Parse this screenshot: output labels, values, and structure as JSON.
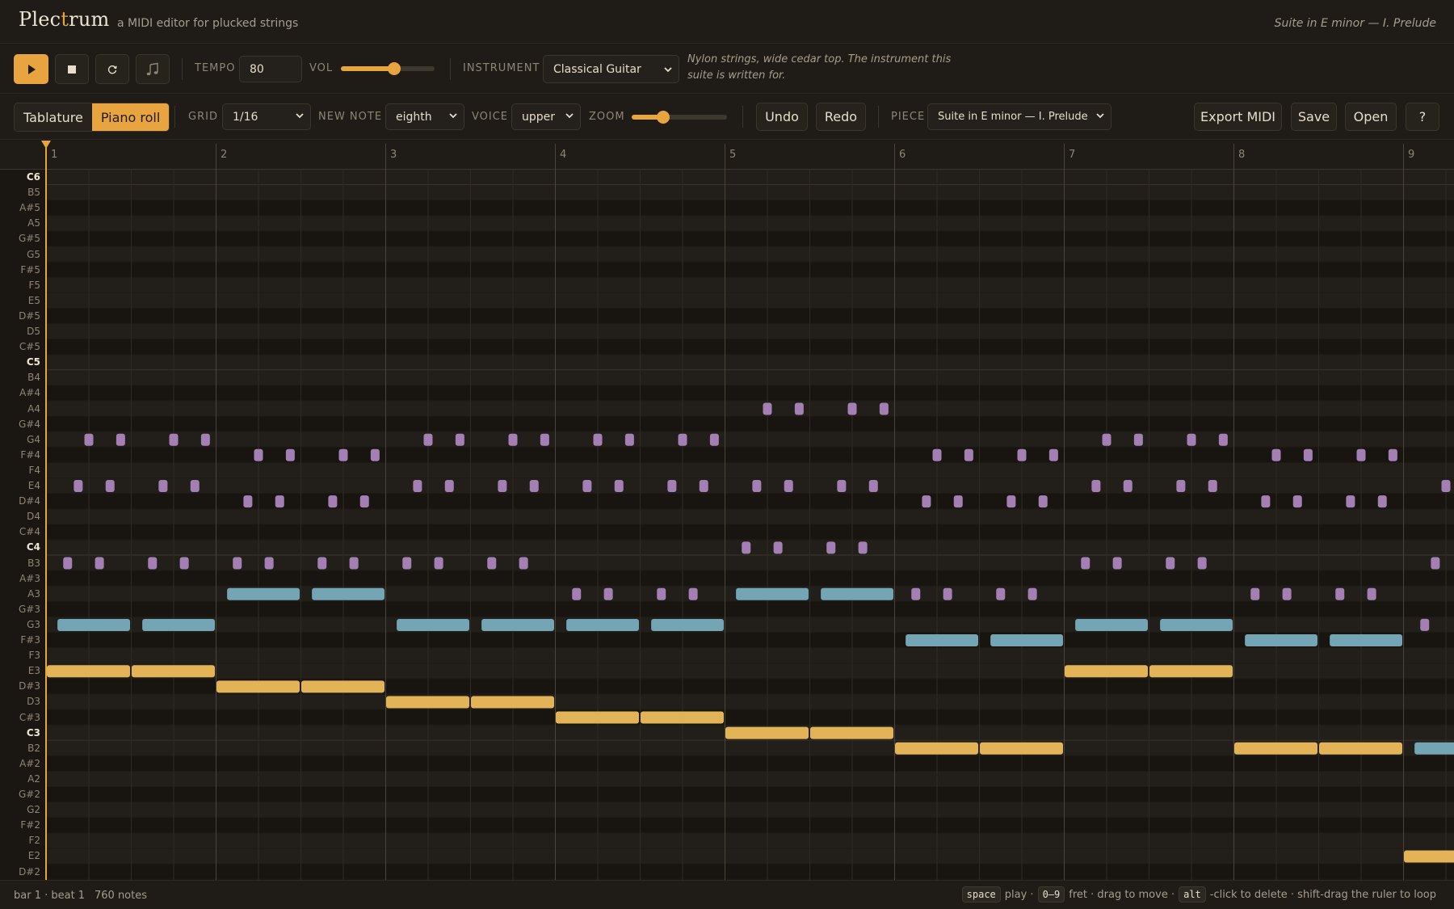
{
  "app": {
    "name": "Plectrum",
    "tagline": "a MIDI editor for plucked strings",
    "current_piece": "Suite in E minor — I. Prelude"
  },
  "transport": {
    "tempo_label": "TEMPO",
    "tempo": "80",
    "vol_label": "VOL",
    "volume": 0.58,
    "instrument_label": "INSTRUMENT",
    "instrument": "Classical Guitar",
    "instrument_description": "Nylon strings, wide cedar top. The instrument this suite is written for."
  },
  "editbar": {
    "views": [
      "Tablature",
      "Piano roll"
    ],
    "active_view": "Piano roll",
    "grid_label": "GRID",
    "grid": "1/16",
    "new_note_label": "NEW NOTE",
    "new_note": "eighth",
    "voice_label": "VOICE",
    "voice": "upper",
    "zoom_label": "ZOOM",
    "zoom": 0.3,
    "undo": "Undo",
    "redo": "Redo",
    "piece_label": "PIECE",
    "piece": "Suite in E minor — I. Prelude",
    "export": "Export MIDI",
    "save": "Save",
    "open": "Open",
    "help": "?"
  },
  "roll": {
    "bar_numbers": [
      "1",
      "2",
      "3",
      "4",
      "5",
      "6",
      "7",
      "8",
      "9"
    ],
    "pitches": [
      "C6",
      "B5",
      "A#5",
      "A5",
      "G#5",
      "G5",
      "F#5",
      "F5",
      "E5",
      "D#5",
      "D5",
      "C#5",
      "C5",
      "B4",
      "A#4",
      "A4",
      "G#4",
      "G4",
      "F#4",
      "F4",
      "E4",
      "D#4",
      "D4",
      "C#4",
      "C4",
      "B3",
      "A#3",
      "A3",
      "G#3",
      "G3",
      "F#3",
      "F3",
      "E3",
      "D#3",
      "D3",
      "C#3",
      "C3",
      "B2",
      "A#2",
      "A2",
      "G#2",
      "G2",
      "F#2",
      "F2",
      "E2",
      "D#2"
    ],
    "colors": {
      "bass": "#e2b457",
      "middle": "#74a5b5",
      "upper": "#a47fb4",
      "playhead": "#e8a43e"
    },
    "bass": [
      [
        "E3",
        1,
        0.5
      ],
      [
        "E3",
        1.5,
        0.5
      ],
      [
        "D#3",
        2,
        0.5
      ],
      [
        "D#3",
        2.5,
        0.5
      ],
      [
        "D3",
        3,
        0.5
      ],
      [
        "D3",
        3.5,
        0.5
      ],
      [
        "C#3",
        4,
        0.5
      ],
      [
        "C#3",
        4.5,
        0.5
      ],
      [
        "C3",
        5,
        0.5
      ],
      [
        "C3",
        5.5,
        0.5
      ],
      [
        "B2",
        6,
        0.5
      ],
      [
        "B2",
        6.5,
        0.5
      ],
      [
        "E3",
        7,
        0.5
      ],
      [
        "E3",
        7.5,
        0.5
      ],
      [
        "B2",
        8,
        0.5
      ],
      [
        "B2",
        8.5,
        0.5
      ],
      [
        "E2",
        9,
        0.5
      ]
    ],
    "middle": [
      [
        "G3",
        1.0625,
        0.4375
      ],
      [
        "G3",
        1.5625,
        0.4375
      ],
      [
        "A3",
        2.0625,
        0.4375
      ],
      [
        "A3",
        2.5625,
        0.4375
      ],
      [
        "G3",
        3.0625,
        0.4375
      ],
      [
        "G3",
        3.5625,
        0.4375
      ],
      [
        "G3",
        4.0625,
        0.4375
      ],
      [
        "G3",
        4.5625,
        0.4375
      ],
      [
        "A3",
        5.0625,
        0.4375
      ],
      [
        "A3",
        5.5625,
        0.4375
      ],
      [
        "F#3",
        6.0625,
        0.4375
      ],
      [
        "F#3",
        6.5625,
        0.4375
      ],
      [
        "G3",
        7.0625,
        0.4375
      ],
      [
        "G3",
        7.5625,
        0.4375
      ],
      [
        "F#3",
        8.0625,
        0.4375
      ],
      [
        "F#3",
        8.5625,
        0.4375
      ],
      [
        "B2",
        9.0625,
        0.4375
      ]
    ],
    "upper": [
      [
        "B3",
        1.125
      ],
      [
        "E4",
        1.1875
      ],
      [
        "G4",
        1.25
      ],
      [
        "B3",
        1.3125
      ],
      [
        "E4",
        1.375
      ],
      [
        "G4",
        1.4375
      ],
      [
        "B3",
        1.625
      ],
      [
        "E4",
        1.6875
      ],
      [
        "G4",
        1.75
      ],
      [
        "B3",
        1.8125
      ],
      [
        "E4",
        1.875
      ],
      [
        "G4",
        1.9375
      ],
      [
        "B3",
        2.125
      ],
      [
        "D#4",
        2.1875
      ],
      [
        "F#4",
        2.25
      ],
      [
        "B3",
        2.3125
      ],
      [
        "D#4",
        2.375
      ],
      [
        "F#4",
        2.4375
      ],
      [
        "B3",
        2.625
      ],
      [
        "D#4",
        2.6875
      ],
      [
        "F#4",
        2.75
      ],
      [
        "B3",
        2.8125
      ],
      [
        "D#4",
        2.875
      ],
      [
        "F#4",
        2.9375
      ],
      [
        "B3",
        3.125
      ],
      [
        "E4",
        3.1875
      ],
      [
        "G4",
        3.25
      ],
      [
        "B3",
        3.3125
      ],
      [
        "E4",
        3.375
      ],
      [
        "G4",
        3.4375
      ],
      [
        "B3",
        3.625
      ],
      [
        "E4",
        3.6875
      ],
      [
        "G4",
        3.75
      ],
      [
        "B3",
        3.8125
      ],
      [
        "E4",
        3.875
      ],
      [
        "G4",
        3.9375
      ],
      [
        "A3",
        4.125
      ],
      [
        "E4",
        4.1875
      ],
      [
        "G4",
        4.25
      ],
      [
        "A3",
        4.3125
      ],
      [
        "E4",
        4.375
      ],
      [
        "G4",
        4.4375
      ],
      [
        "A3",
        4.625
      ],
      [
        "E4",
        4.6875
      ],
      [
        "G4",
        4.75
      ],
      [
        "A3",
        4.8125
      ],
      [
        "E4",
        4.875
      ],
      [
        "G4",
        4.9375
      ],
      [
        "C4",
        5.125
      ],
      [
        "E4",
        5.1875
      ],
      [
        "A4",
        5.25
      ],
      [
        "C4",
        5.3125
      ],
      [
        "E4",
        5.375
      ],
      [
        "A4",
        5.4375
      ],
      [
        "C4",
        5.625
      ],
      [
        "E4",
        5.6875
      ],
      [
        "A4",
        5.75
      ],
      [
        "C4",
        5.8125
      ],
      [
        "E4",
        5.875
      ],
      [
        "A4",
        5.9375
      ],
      [
        "A3",
        6.125
      ],
      [
        "D#4",
        6.1875
      ],
      [
        "F#4",
        6.25
      ],
      [
        "A3",
        6.3125
      ],
      [
        "D#4",
        6.375
      ],
      [
        "F#4",
        6.4375
      ],
      [
        "A3",
        6.625
      ],
      [
        "D#4",
        6.6875
      ],
      [
        "F#4",
        6.75
      ],
      [
        "A3",
        6.8125
      ],
      [
        "D#4",
        6.875
      ],
      [
        "F#4",
        6.9375
      ],
      [
        "B3",
        7.125
      ],
      [
        "E4",
        7.1875
      ],
      [
        "G4",
        7.25
      ],
      [
        "B3",
        7.3125
      ],
      [
        "E4",
        7.375
      ],
      [
        "G4",
        7.4375
      ],
      [
        "B3",
        7.625
      ],
      [
        "E4",
        7.6875
      ],
      [
        "G4",
        7.75
      ],
      [
        "B3",
        7.8125
      ],
      [
        "E4",
        7.875
      ],
      [
        "G4",
        7.9375
      ],
      [
        "A3",
        8.125
      ],
      [
        "D#4",
        8.1875
      ],
      [
        "F#4",
        8.25
      ],
      [
        "A3",
        8.3125
      ],
      [
        "D#4",
        8.375
      ],
      [
        "F#4",
        8.4375
      ],
      [
        "A3",
        8.625
      ],
      [
        "D#4",
        8.6875
      ],
      [
        "F#4",
        8.75
      ],
      [
        "A3",
        8.8125
      ],
      [
        "D#4",
        8.875
      ],
      [
        "F#4",
        8.9375
      ],
      [
        "G3",
        9.125
      ],
      [
        "B3",
        9.1875
      ],
      [
        "E4",
        9.25
      ]
    ]
  },
  "status": {
    "position": "bar 1 · beat 1",
    "note_count": "760 notes",
    "hints": [
      {
        "key": "space",
        "text": "play ·"
      },
      {
        "key": "0–9",
        "text": "fret · drag to move ·"
      },
      {
        "key": "alt",
        "text": "-click to delete · shift-drag the ruler to loop"
      }
    ]
  }
}
